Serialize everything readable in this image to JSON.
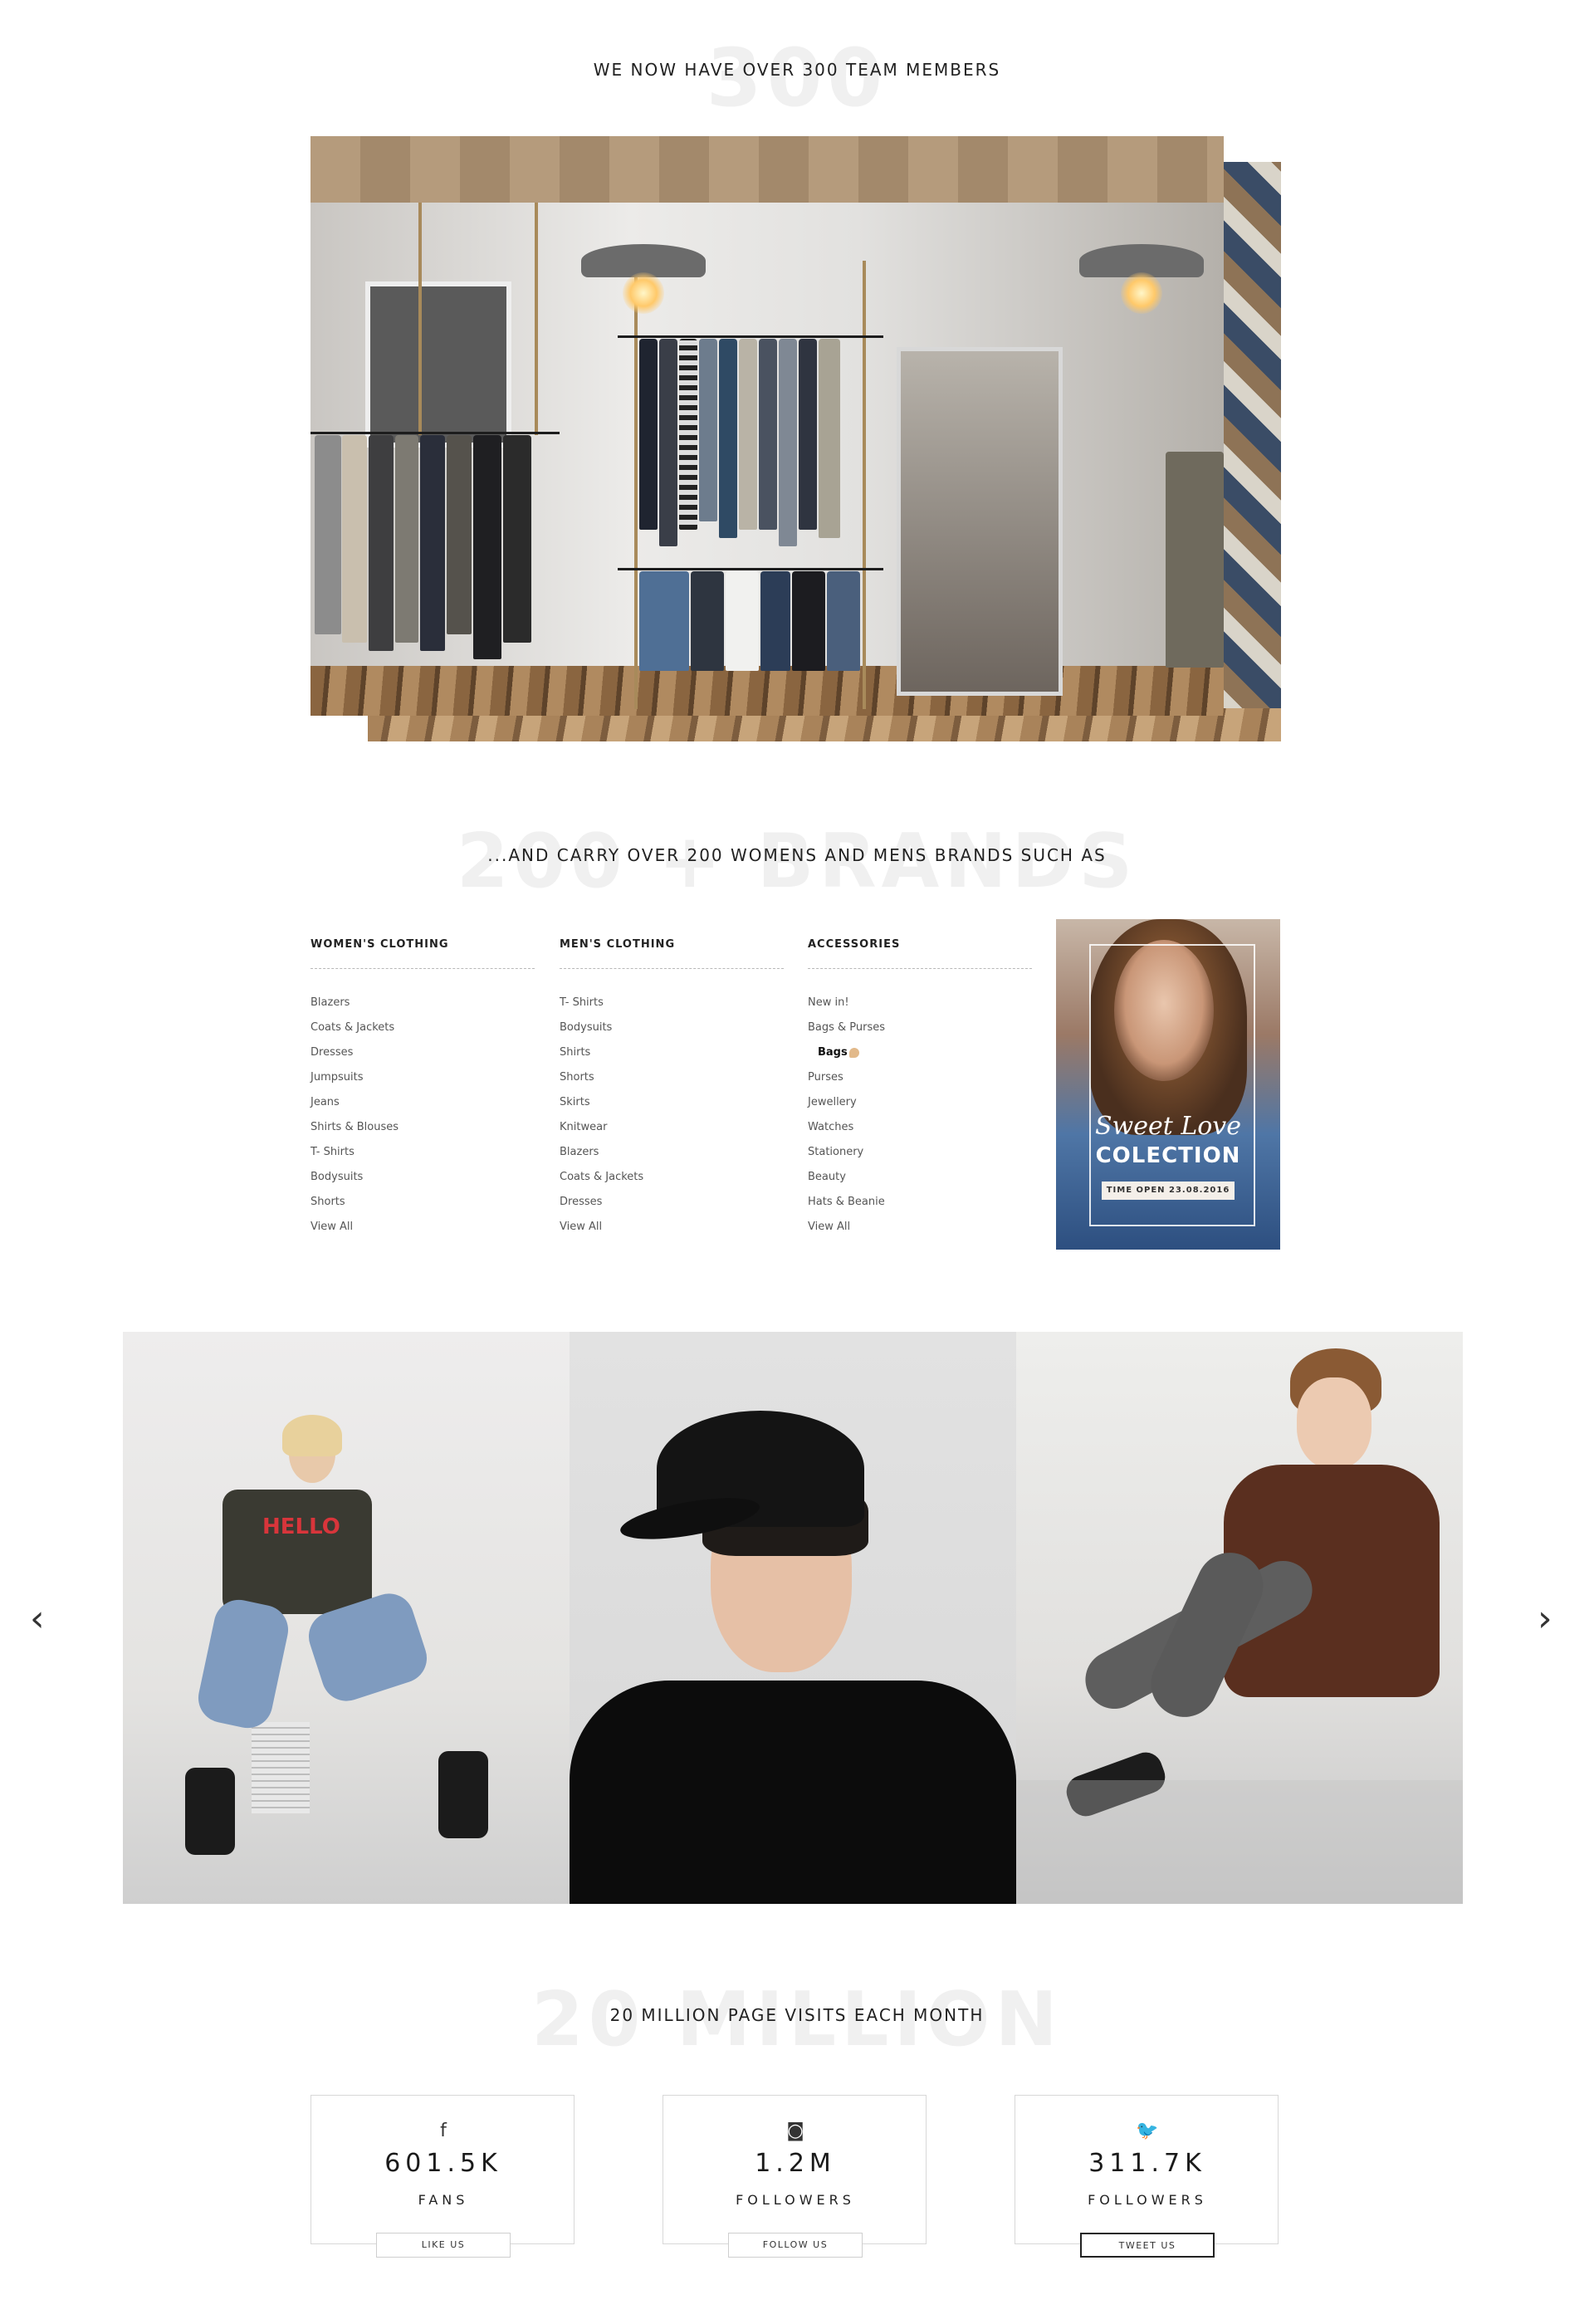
{
  "team": {
    "bg_number": "300",
    "headline": "WE NOW HAVE OVER 300 TEAM MEMBERS"
  },
  "brands": {
    "bg_text": "200 + BRANDS",
    "headline": "...AND CARRY OVER 200 WOMENS AND MENS BRANDS SUCH AS"
  },
  "menu": {
    "womens": {
      "title": "WOMEN'S CLOTHING",
      "items": [
        "Blazers",
        "Coats & Jackets",
        "Dresses",
        "Jumpsuits",
        "Jeans",
        "Shirts & Blouses",
        "T- Shirts",
        "Bodysuits",
        "Shorts",
        "View All"
      ]
    },
    "mens": {
      "title": "MEN'S CLOTHING",
      "items": [
        "T- Shirts",
        "Bodysuits",
        "Shirts",
        "Shorts",
        "Skirts",
        "Knitwear",
        "Blazers",
        "Coats & Jackets",
        "Dresses",
        "View All"
      ]
    },
    "accessories": {
      "title": "ACCESSORIES",
      "items": [
        "New in!",
        "Bags & Purses",
        "Bags",
        "Purses",
        "Jewellery",
        "Watches",
        "Stationery",
        "Beauty",
        "Hats & Beanie",
        "View All"
      ],
      "active_index": 2
    }
  },
  "promo": {
    "script": "Sweet Love",
    "title": "COLECTION",
    "date": "TIME OPEN 23.08.2016"
  },
  "gallery": {
    "prev_icon": "chevron-left-icon",
    "next_icon": "chevron-right-icon",
    "shirt_text": "HELLO"
  },
  "visits": {
    "bg_text": "20 MILLION",
    "headline": "20 MILLION PAGE VISITS EACH MONTH"
  },
  "social": [
    {
      "icon": "facebook-icon",
      "glyph": "f",
      "count": "601.5K",
      "label": "FANS",
      "button": "LIKE US",
      "color": "#333333"
    },
    {
      "icon": "instagram-icon",
      "glyph": "◙",
      "count": "1.2M",
      "label": "FOLLOWERS",
      "button": "FOLLOW US",
      "color": "#333333"
    },
    {
      "icon": "twitter-icon",
      "glyph": "🐦",
      "count": "311.7K",
      "label": "FOLLOWERS",
      "button": "TWEET US",
      "color": "#3aa3e3"
    }
  ]
}
